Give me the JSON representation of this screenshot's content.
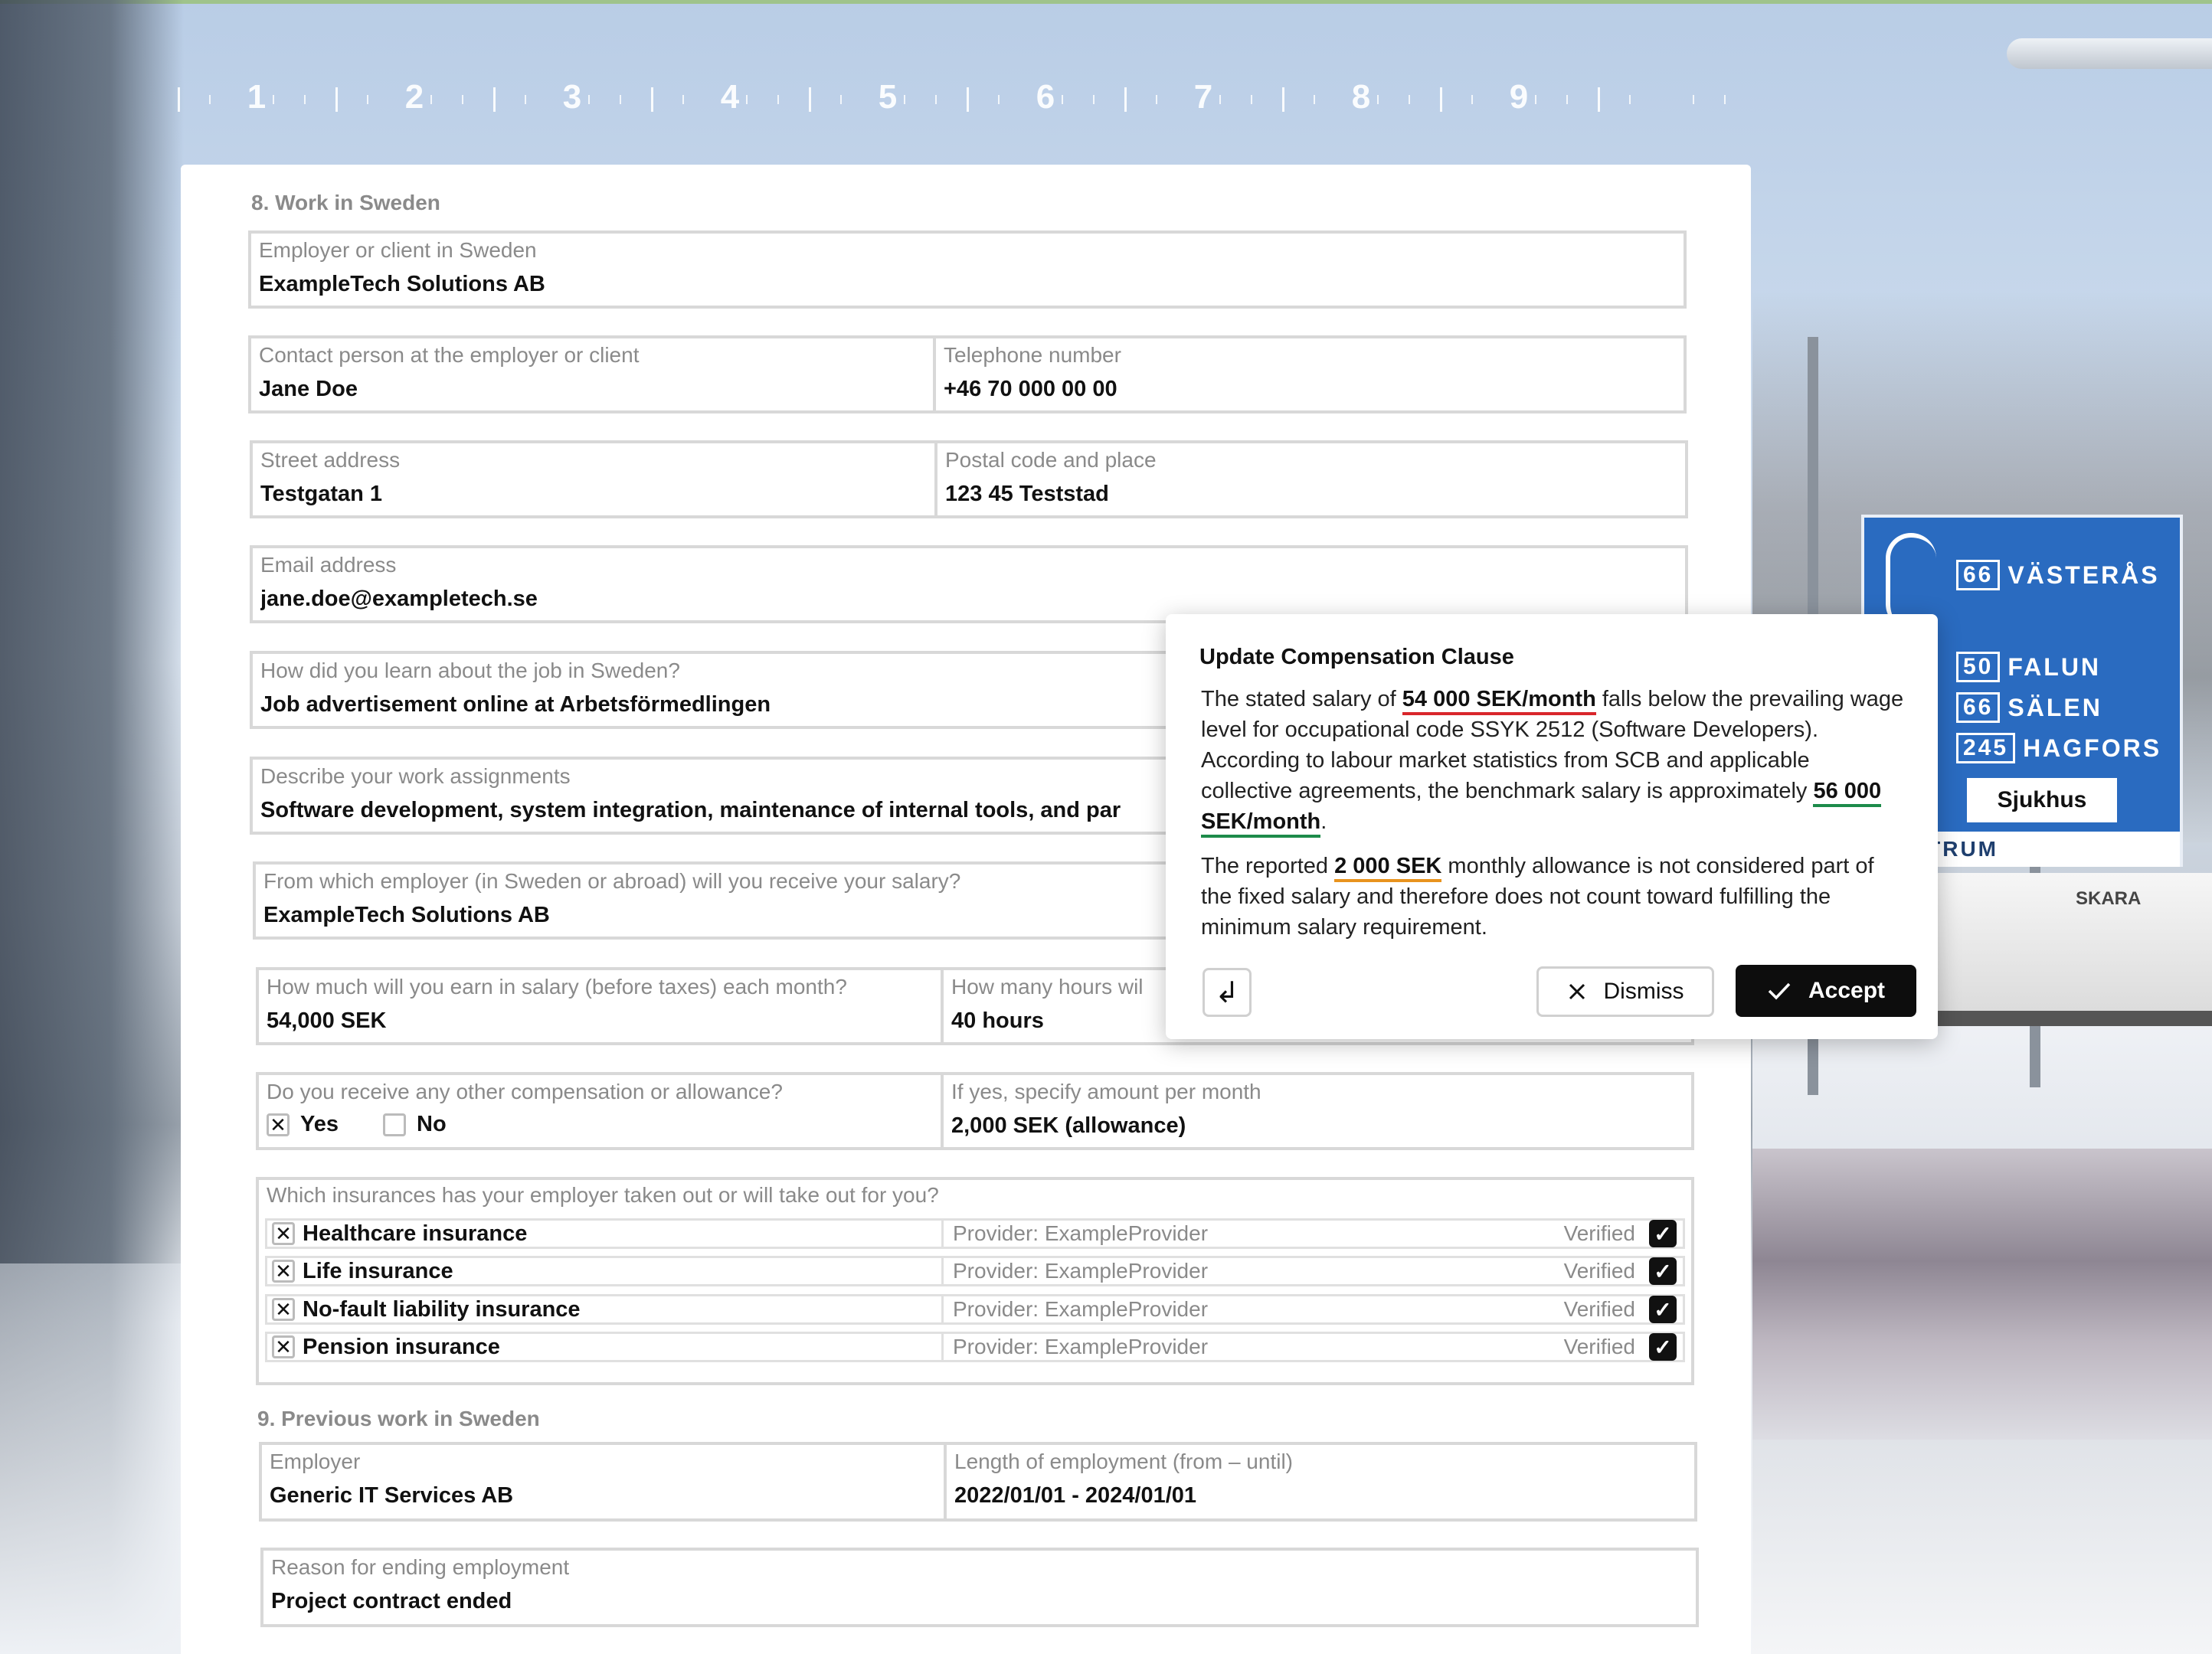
{
  "ruler": {
    "numbers": [
      "1",
      "2",
      "3",
      "4",
      "5",
      "6",
      "7",
      "8",
      "9"
    ]
  },
  "sign": {
    "rows": [
      {
        "num": "66",
        "place": "VÄSTERÅS"
      },
      {
        "num": "50",
        "place": "FALUN"
      },
      {
        "num": "66",
        "place": "SÄLEN"
      },
      {
        "num": "245",
        "place": "HAGFORS"
      }
    ],
    "white_label": "Sjukhus",
    "bottom_label": "CENTRUM",
    "truck_label": "SKARA"
  },
  "section8": {
    "title": "8. Work in Sweden",
    "employer": {
      "label": "Employer or client in Sweden",
      "value": "ExampleTech Solutions AB"
    },
    "contact": {
      "label": "Contact person at the employer or client",
      "value": "Jane Doe"
    },
    "phone": {
      "label": "Telephone number",
      "value": "+46 70 000 00 00"
    },
    "street": {
      "label": "Street address",
      "value": "Testgatan 1"
    },
    "postal": {
      "label": "Postal code and place",
      "value": "123 45 Teststad"
    },
    "email": {
      "label": "Email address",
      "value": "jane.doe@exampletech.se"
    },
    "learn": {
      "label": "How did you learn about the job in Sweden?",
      "value": "Job advertisement online at Arbetsförmedlingen"
    },
    "assignments": {
      "label": "Describe your work assignments",
      "value": "Software development, system integration, maintenance of internal tools, and par"
    },
    "salary_from": {
      "label": "From which employer (in Sweden or abroad) will you receive your salary?",
      "value": "ExampleTech Solutions AB"
    },
    "salary": {
      "label": "How much will you earn in salary (before taxes) each month?",
      "value": "54,000 SEK"
    },
    "hours": {
      "label": "How many hours wil",
      "value": "40 hours"
    },
    "compensation": {
      "label": "Do you receive any other compensation or allowance?",
      "yes": "Yes",
      "no": "No",
      "yes_mark": "✕"
    },
    "amount": {
      "label": "If yes, specify amount per month",
      "value_main": "2,000 SEK",
      "value_suffix": " (allowance)"
    },
    "insurance": {
      "label": "Which insurances has your employer taken out or will take out for you?",
      "items": [
        {
          "name": "Healthcare insurance",
          "provider": "Provider: ExampleProvider",
          "status": "Verified"
        },
        {
          "name": "Life insurance",
          "provider": "Provider: ExampleProvider",
          "status": "Verified"
        },
        {
          "name": "No-fault liability insurance",
          "provider": "Provider: ExampleProvider",
          "status": "Verified"
        },
        {
          "name": "Pension insurance",
          "provider": "Provider: ExampleProvider",
          "status": "Verified"
        }
      ]
    }
  },
  "section9": {
    "title": "9. Previous work in Sweden",
    "employer": {
      "label": "Employer",
      "value": "Generic IT Services AB"
    },
    "length": {
      "label": "Length of employment (from – until)",
      "value": "2022/01/01 - 2024/01/01"
    },
    "reason": {
      "label": "Reason for ending employment",
      "value": "Project contract ended"
    }
  },
  "popup": {
    "title": "Update Compensation Clause",
    "p1_a": "The stated salary of ",
    "p1_hl1": "54 000 SEK/month",
    "p1_b": " falls below the prevailing wage level for occupational code SSYK 2512 (Software Developers). According to labour market statistics from SCB and applicable collective agreements, the benchmark salary is approximately ",
    "p1_hl2": "56 000 SEK/month",
    "p1_c": ".",
    "p2_a": "The reported ",
    "p2_hl": "2 000 SEK",
    "p2_b": " monthly allowance is not considered part of the fixed salary and therefore does not count toward fulfilling the minimum salary requirement.",
    "enter_glyph": "↲",
    "dismiss_label": "Dismiss",
    "accept_label": "Accept"
  },
  "colors": {
    "accent_red": "#d9262b",
    "accent_orange": "#e8931e",
    "accent_green": "#1d8b4a"
  }
}
